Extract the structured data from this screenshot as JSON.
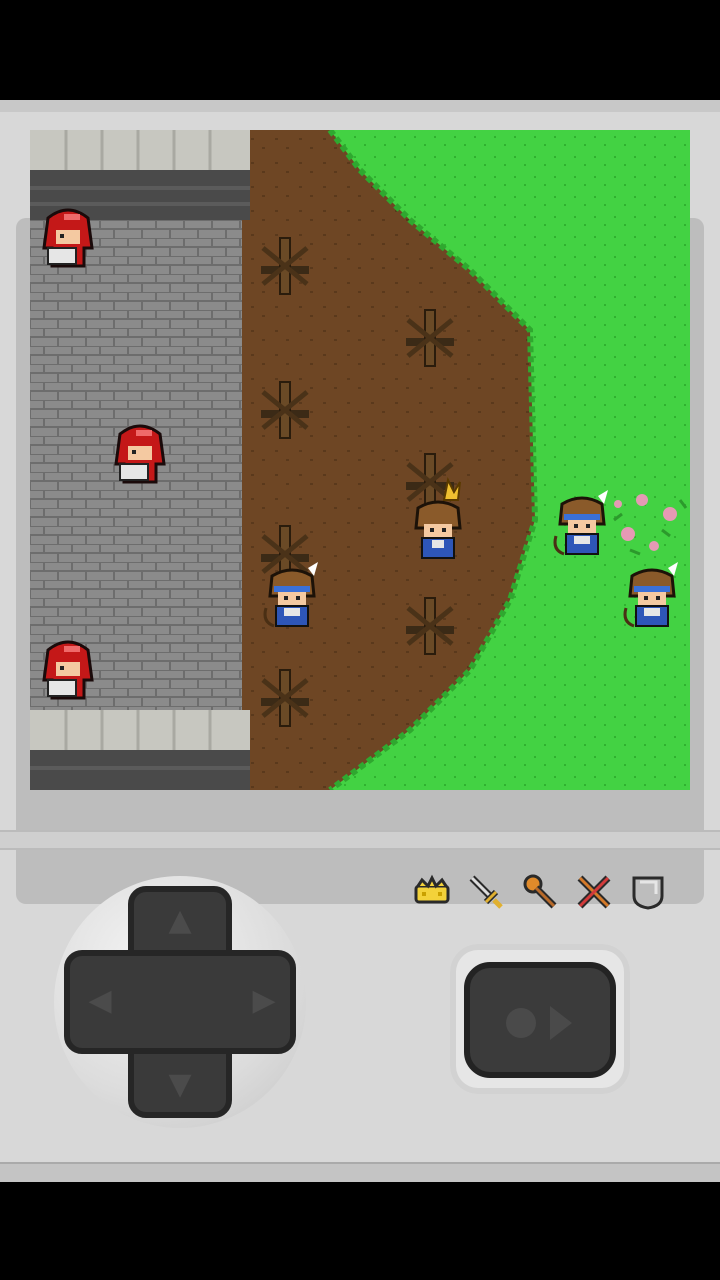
{
  "colors": {
    "wall": "#8a8a8a",
    "dirt": "#6b4423",
    "grass": "#3ccf3c",
    "device": "#d8d8d8"
  },
  "scene": {
    "ally_soldiers": 3,
    "enemy_soldiers": 4
  },
  "inventory": {
    "items": [
      "crown-icon",
      "sword-icon",
      "torch-icon",
      "crossed-swords-icon",
      "shield-icon"
    ]
  },
  "controls": {
    "dpad": "dpad",
    "action": "action-button"
  }
}
